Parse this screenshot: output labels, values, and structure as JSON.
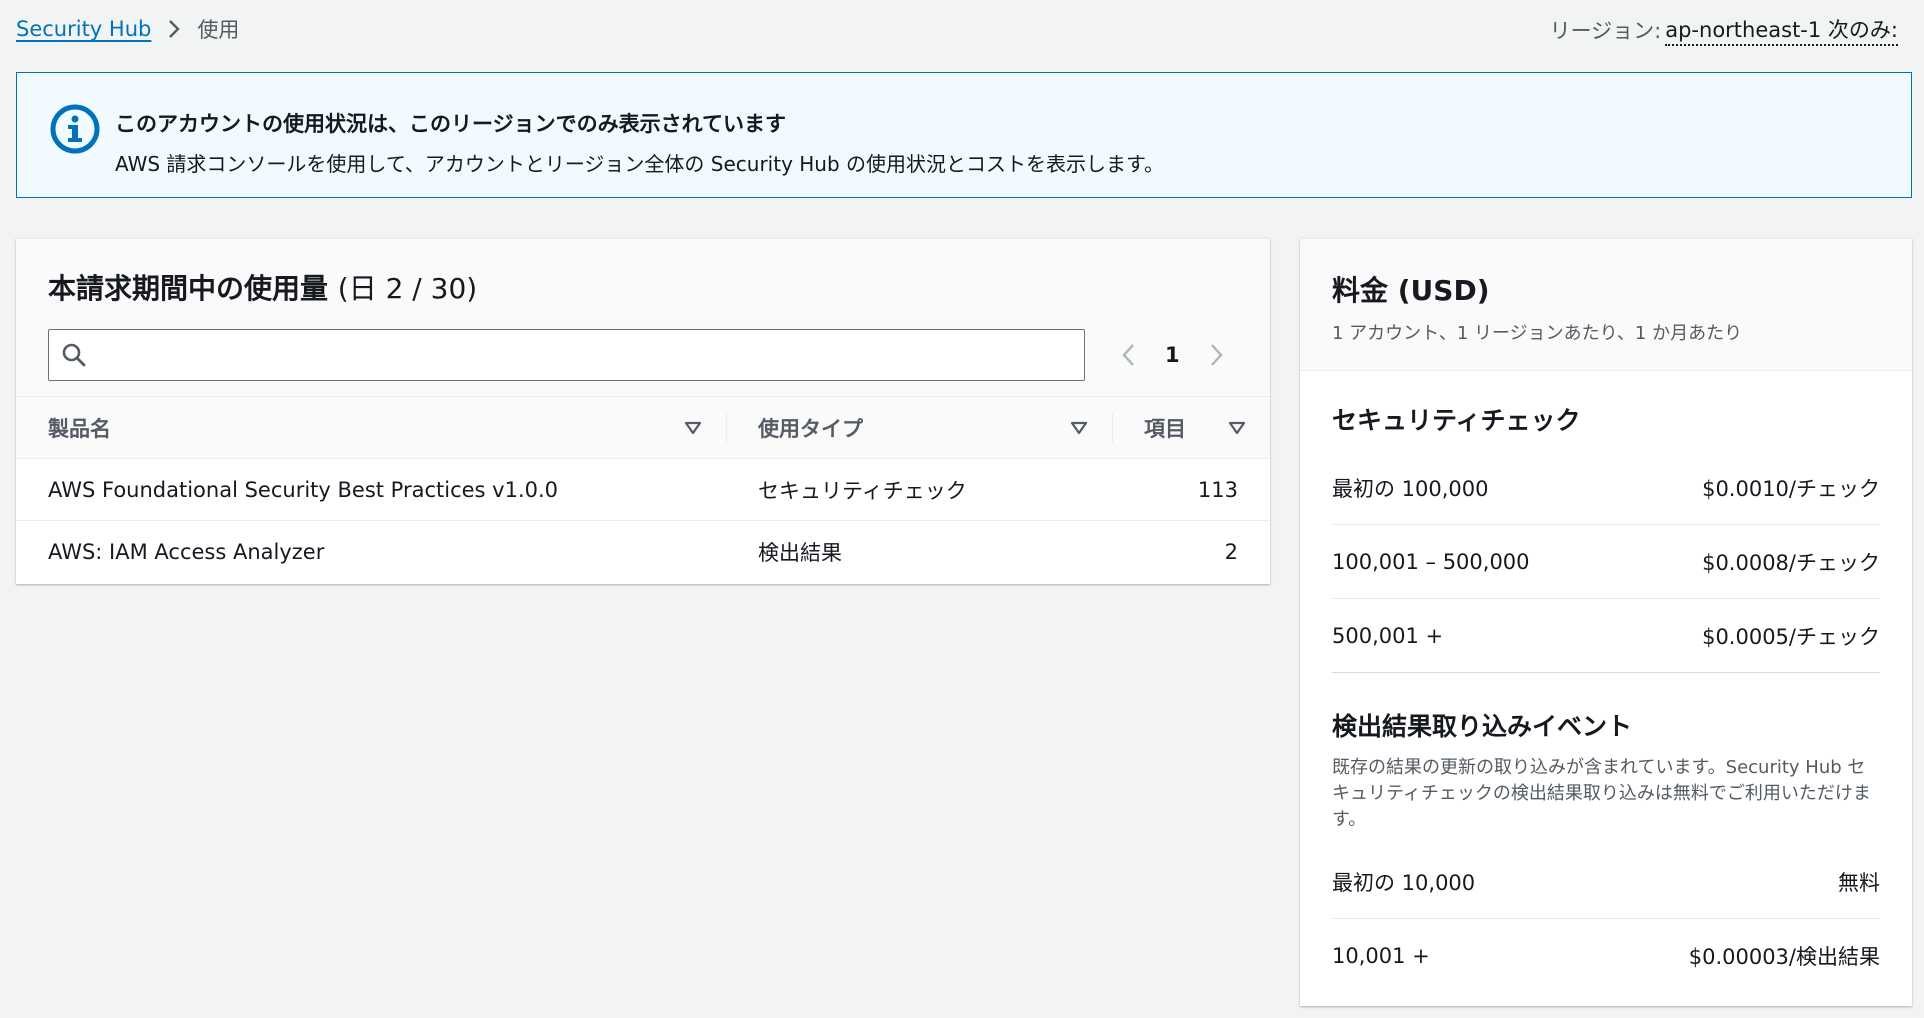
{
  "breadcrumb": {
    "root": "Security Hub",
    "current": "使用"
  },
  "region": {
    "label": "リージョン:",
    "value": "ap-northeast-1 次のみ:"
  },
  "flash": {
    "title": "このアカウントの使用状況は、このリージョンでのみ表示されています",
    "text": "AWS 請求コンソールを使用して、アカウントとリージョン全体の Security Hub の使用状況とコストを表示します。"
  },
  "usage": {
    "title": "本請求期間中の使用量",
    "title_count": "(日 2 / 30)",
    "search": {
      "value": "",
      "placeholder": ""
    },
    "pagination": {
      "current_page": "1"
    },
    "columns": [
      "製品名",
      "使用タイプ",
      "項目"
    ],
    "rows": [
      {
        "name": "AWS Foundational Security Best Practices v1.0.0",
        "type": "セキュリティチェック",
        "items": "113"
      },
      {
        "name": "AWS: IAM Access Analyzer",
        "type": "検出結果",
        "items": "2"
      }
    ]
  },
  "pricing": {
    "title": "料金 (USD)",
    "subtitle": "1 アカウント、1 リージョンあたり、1 か月あたり",
    "security_checks": {
      "title": "セキュリティチェック",
      "tiers": [
        {
          "range": "最初の 100,000",
          "price": "$0.0010/チェック"
        },
        {
          "range": "100,001 – 500,000",
          "price": "$0.0008/チェック"
        },
        {
          "range": "500,001 +",
          "price": "$0.0005/チェック"
        }
      ]
    },
    "finding_ingestion": {
      "title": "検出結果取り込みイベント",
      "description": "既存の結果の更新の取り込みが含まれています。Security Hub セキュリティチェックの検出結果取り込みは無料でご利用いただけます。",
      "tiers": [
        {
          "range": "最初の 10,000",
          "price": "無料"
        },
        {
          "range": "10,001 +",
          "price": "$0.00003/検出結果"
        }
      ]
    }
  },
  "colors": {
    "link": "#0073bb",
    "info_border": "#0073bb",
    "info_bg": "#f1faff",
    "page_bg": "#f2f3f3"
  }
}
